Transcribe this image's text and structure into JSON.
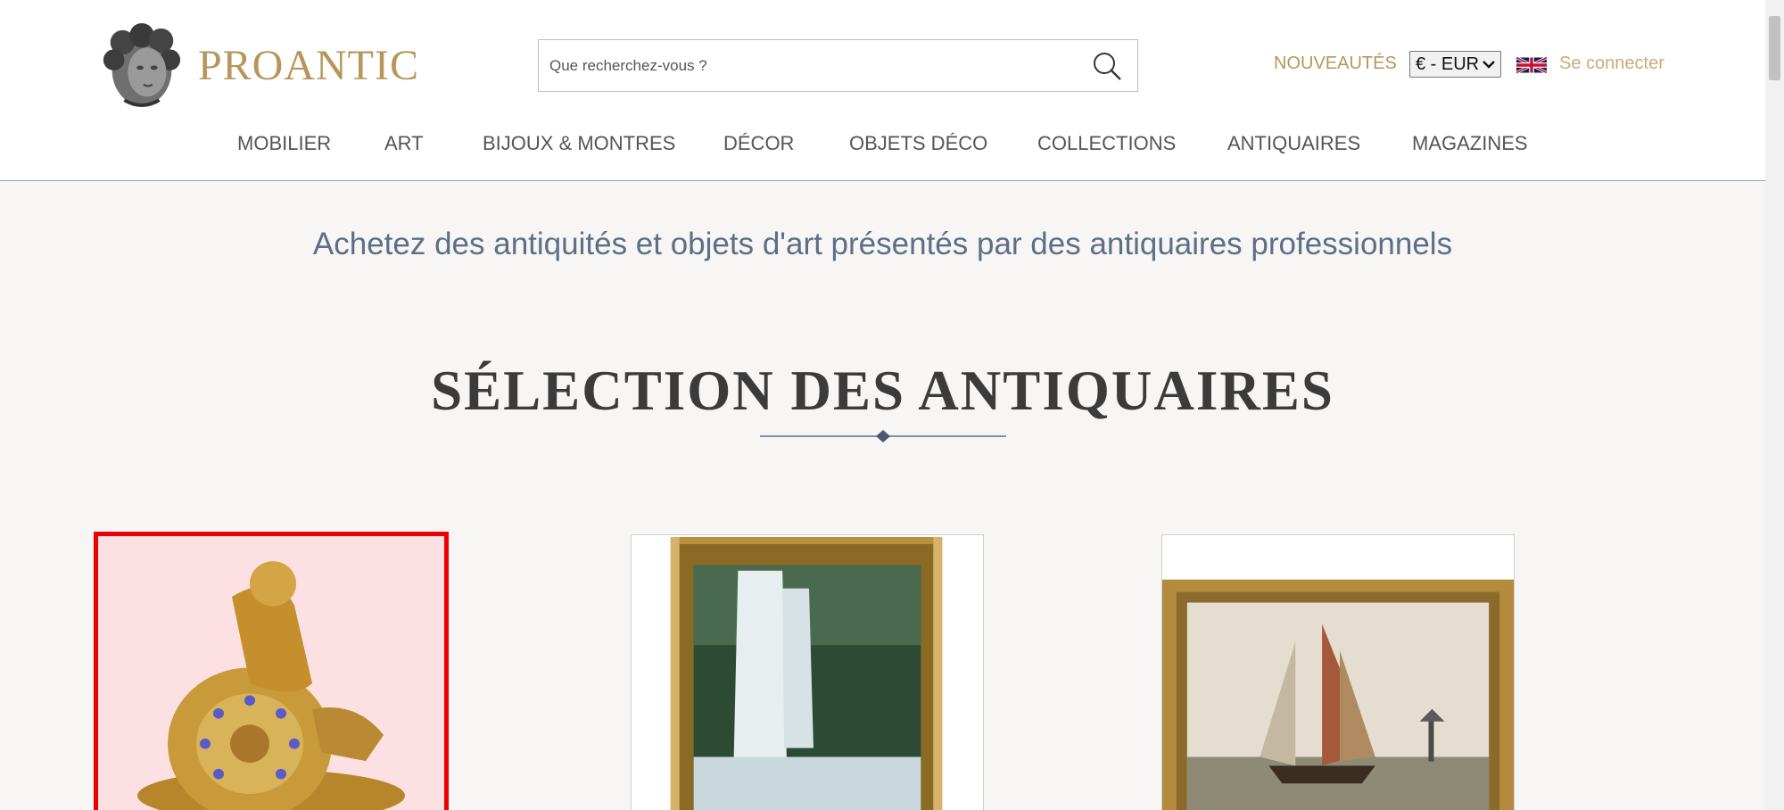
{
  "header": {
    "logo_text": "PROANTIC",
    "search": {
      "placeholder": "Que recherchez-vous ?",
      "value": ""
    },
    "nouveautes_label": "NOUVEAUTÉS",
    "currency": {
      "selected": "€ - EUR"
    },
    "language_flag": "uk-flag-icon",
    "login_label": "Se connecter"
  },
  "nav": {
    "items": [
      {
        "label": "MOBILIER"
      },
      {
        "label": "ART"
      },
      {
        "label": "BIJOUX & MONTRES"
      },
      {
        "label": "DÉCOR"
      },
      {
        "label": "OBJETS DÉCO"
      },
      {
        "label": "COLLECTIONS"
      },
      {
        "label": "ANTIQUAIRES"
      },
      {
        "label": "MAGAZINES"
      }
    ]
  },
  "main": {
    "tagline": "Achetez des antiquités et objets d'art présentés par des antiquaires professionnels",
    "section_title": "SÉLECTION DES ANTIQUAIRES",
    "products": [
      {
        "image": "gilt-bronze-clock-icon",
        "selected": true
      },
      {
        "image": "waterfall-painting-icon",
        "selected": false
      },
      {
        "image": "sailing-ship-painting-icon",
        "selected": false
      }
    ]
  },
  "colors": {
    "brand_gold": "#b8965a",
    "tagline_blue": "#5c6f86",
    "selection_red": "#ee0000"
  }
}
